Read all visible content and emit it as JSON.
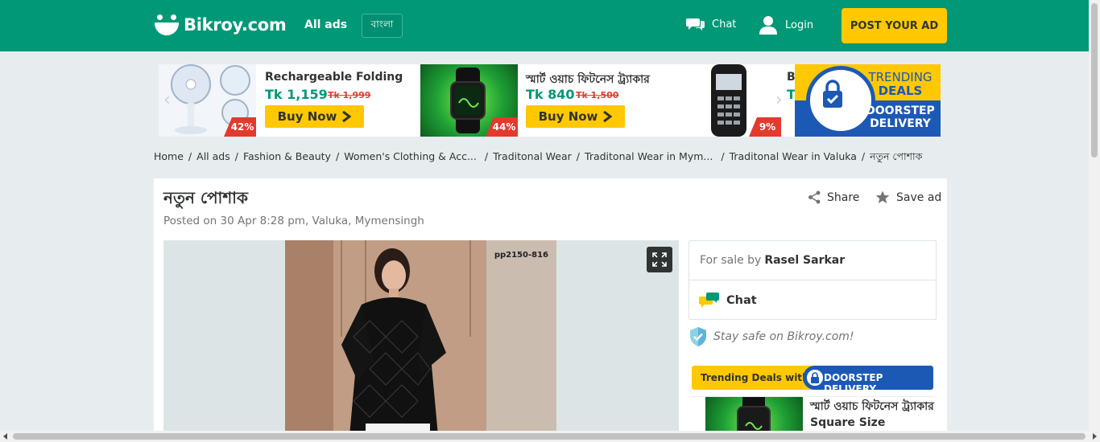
{
  "header": {
    "logo_text": "Bikroy.com",
    "all_ads": "All ads",
    "language": "বাংলা",
    "chat": "Chat",
    "login": "Login",
    "post_ad": "POST YOUR AD",
    "brand_color": "#009877",
    "accent_color": "#ffc800"
  },
  "banner": {
    "promos": [
      {
        "title": "Rechargeable Folding",
        "price": "Tk 1,159",
        "old_price": "Tk 1,999",
        "discount": "42%",
        "cta": "Buy Now"
      },
      {
        "title": "স্মার্ট ওয়াচ ফিটনেস ট্র্যাকার",
        "price": "Tk 840",
        "old_price": "Tk 1,500",
        "discount": "44%",
        "cta": "Buy Now"
      },
      {
        "title": "Bm",
        "price": "Tk",
        "discount": "9%"
      }
    ],
    "badge": {
      "line1": "TRENDING",
      "line2": "DEALS",
      "line3": "DOORSTEP",
      "line4": "DELIVERY"
    }
  },
  "breadcrumb": [
    "Home",
    "All ads",
    "Fashion & Beauty",
    "Women's Clothing & Acc...",
    "Traditonal Wear",
    "Traditonal Wear in Mym...",
    "Traditonal Wear in Valuka",
    "নতুন পোশাক"
  ],
  "ad": {
    "title": "নতুন পোশাক",
    "posted": "Posted on 30 Apr 8:28 pm, Valuka, Mymensingh",
    "share": "Share",
    "save": "Save ad",
    "photo_code": "pp2150-816"
  },
  "seller": {
    "for_sale_by": "For sale by",
    "name": "Rasel Sarkar",
    "chat": "Chat",
    "stay_safe": "Stay safe on Bikroy.com!"
  },
  "trending": {
    "label": "Trending Deals with",
    "delivery": "DOORSTEP DELIVERY",
    "item_title_1": "স্মার্ট ওয়াচ ফিটনেস ট্র্যাকার",
    "item_title_2": "Square Size"
  }
}
